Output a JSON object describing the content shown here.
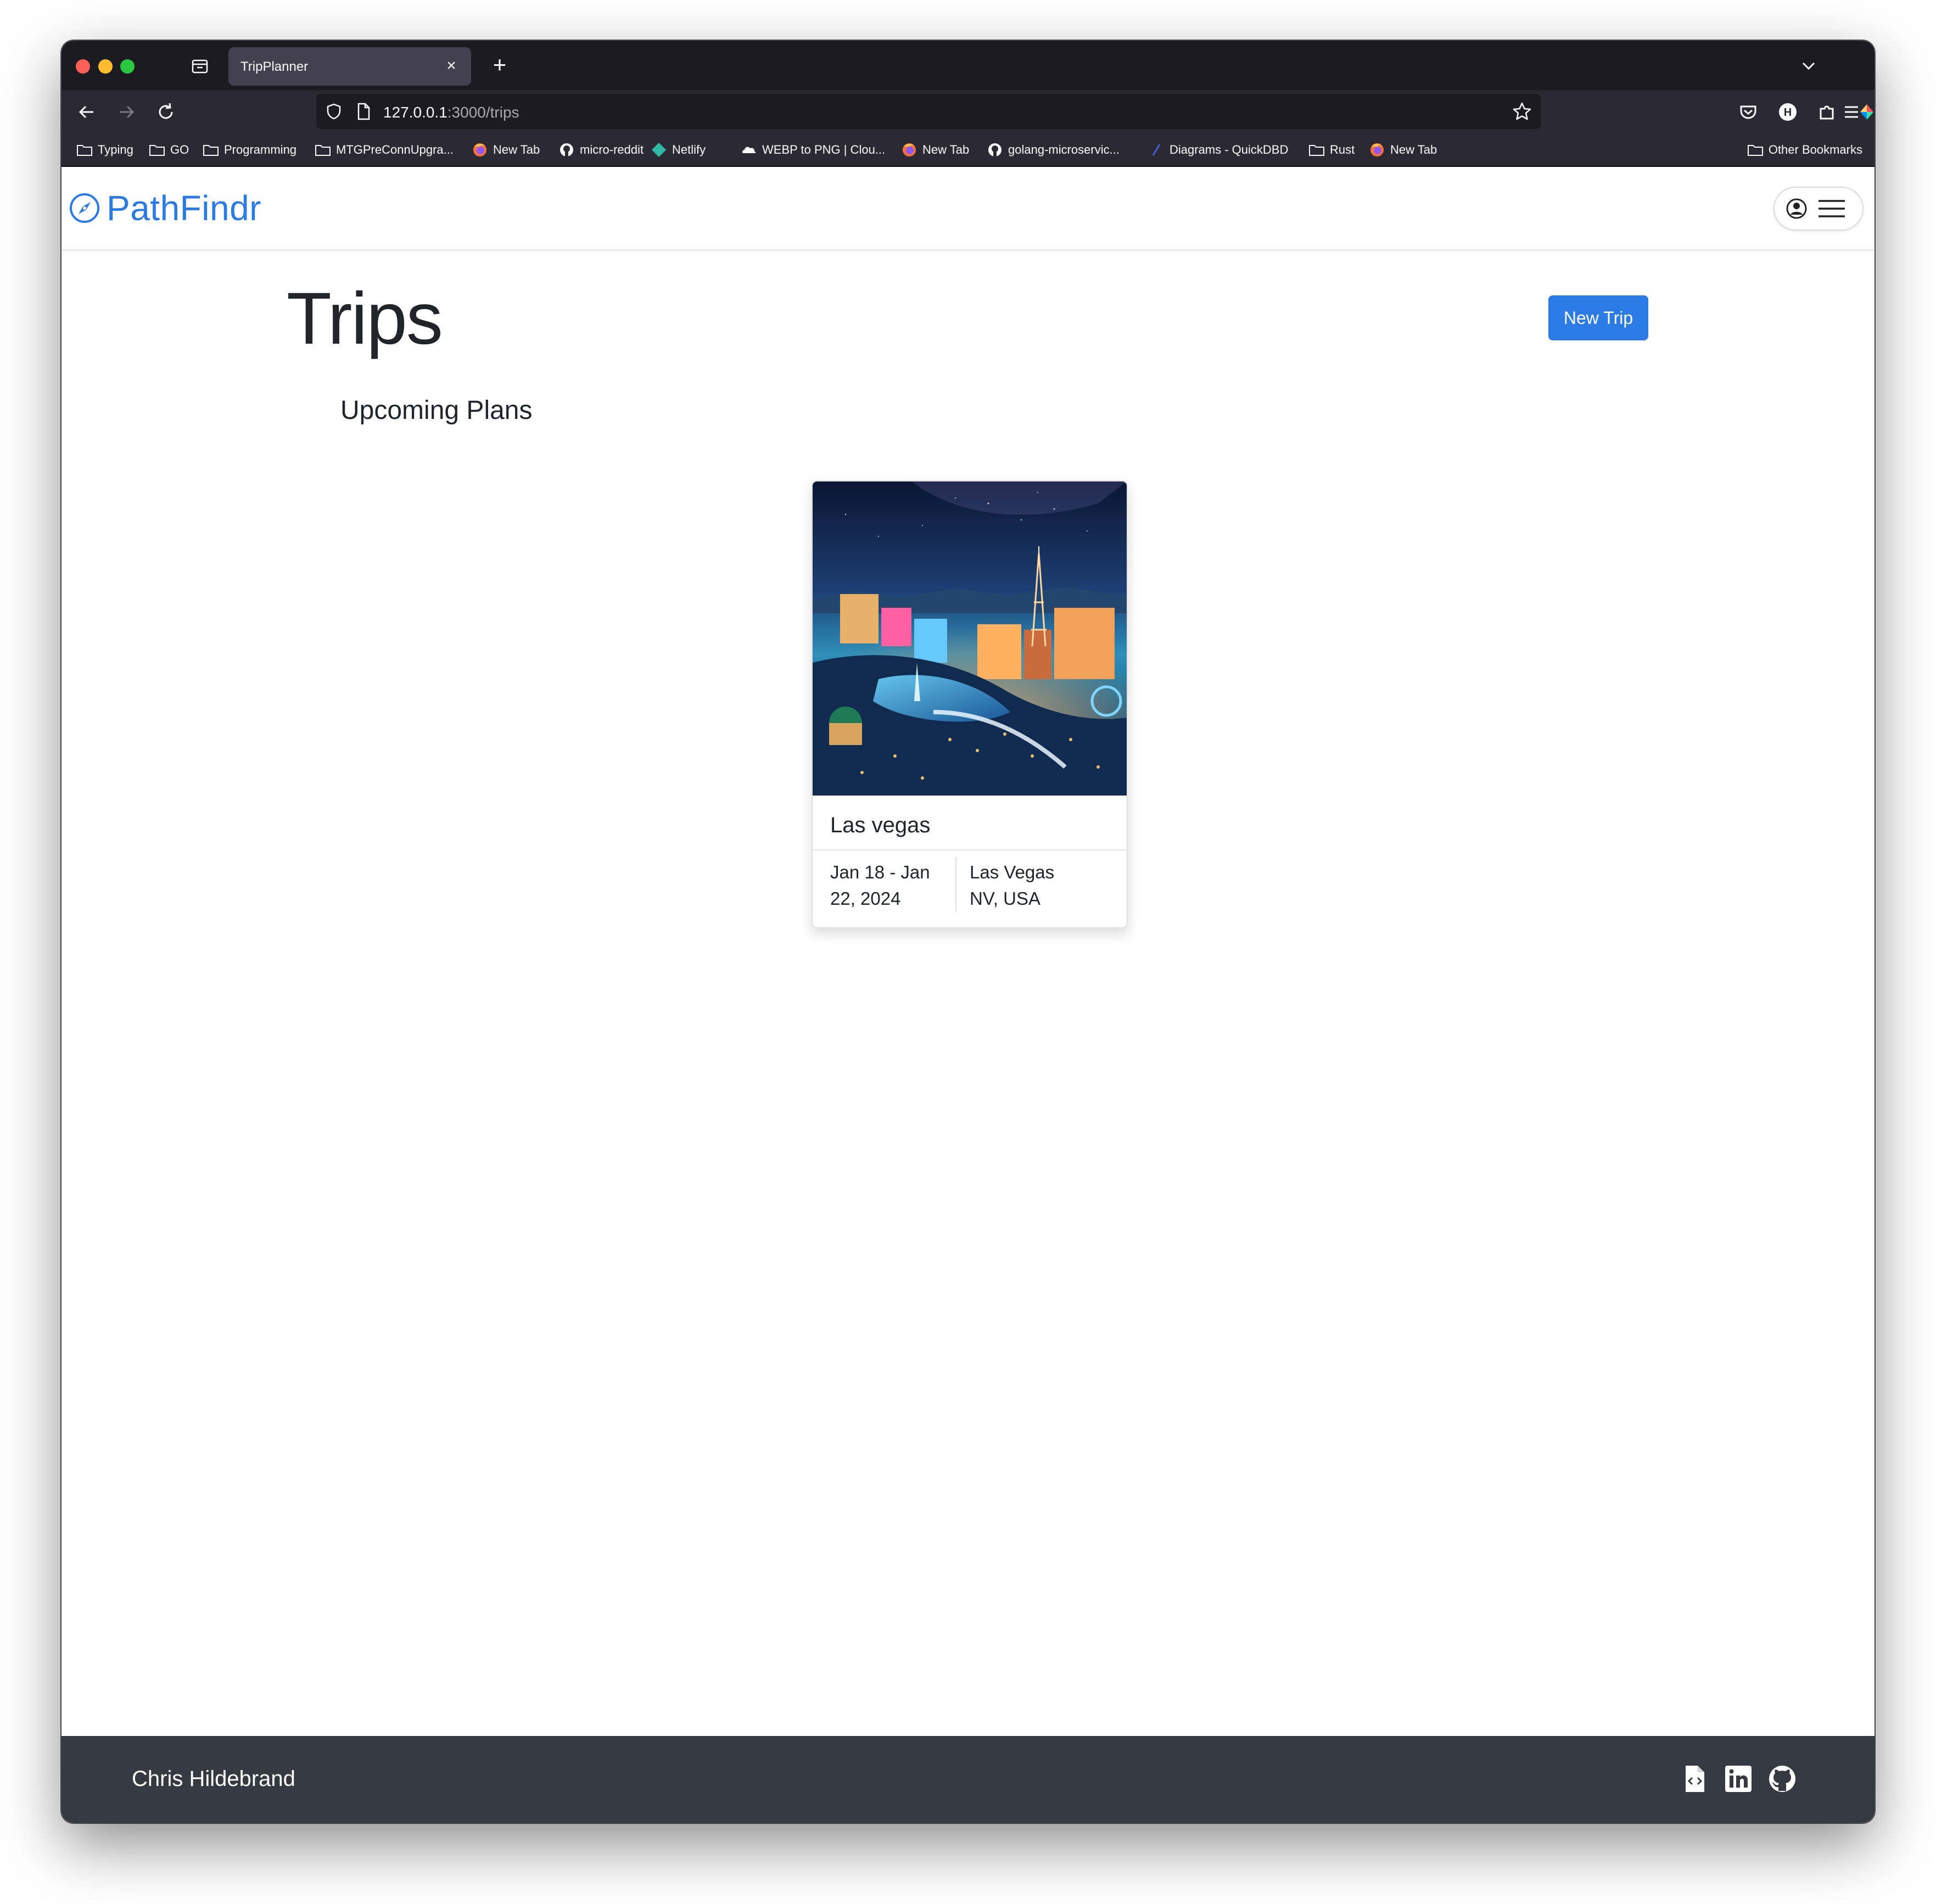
{
  "browser": {
    "tab_title": "TripPlanner",
    "url_host": "127.0.0.1",
    "url_path": ":3000/trips",
    "bookmarks": [
      {
        "label": "Typing",
        "icon": "folder-icon"
      },
      {
        "label": "GO",
        "icon": "folder-icon"
      },
      {
        "label": "Programming",
        "icon": "folder-icon"
      },
      {
        "label": "MTGPreConnUpgra...",
        "icon": "folder-icon"
      },
      {
        "label": "New Tab",
        "icon": "firefox-icon"
      },
      {
        "label": "micro-reddit",
        "icon": "github-icon"
      },
      {
        "label": "Netlify",
        "icon": "netlify-icon"
      },
      {
        "label": "WEBP to PNG | Clou...",
        "icon": "cloud-icon"
      },
      {
        "label": "New Tab",
        "icon": "firefox-icon"
      },
      {
        "label": "golang-microservic...",
        "icon": "github-icon"
      },
      {
        "label": "Diagrams - QuickDBD",
        "icon": "quickdbd-icon"
      },
      {
        "label": "Rust",
        "icon": "folder-icon"
      },
      {
        "label": "New Tab",
        "icon": "firefox-icon"
      }
    ],
    "other_bookmarks": "Other Bookmarks"
  },
  "app": {
    "brand": "PathFindr",
    "brand_color": "#2c7be5",
    "page_title": "Trips",
    "new_trip_label": "New Trip",
    "section_title": "Upcoming Plans",
    "trips": [
      {
        "name": "Las vegas",
        "dates_line1": "Jan 18 - Jan",
        "dates_line2": "22, 2024",
        "location_line1": "Las Vegas",
        "location_line2": "NV, USA"
      }
    ]
  },
  "footer": {
    "name": "Chris Hildebrand",
    "icons": [
      "resume-file-icon",
      "linkedin-icon",
      "github-icon"
    ]
  }
}
